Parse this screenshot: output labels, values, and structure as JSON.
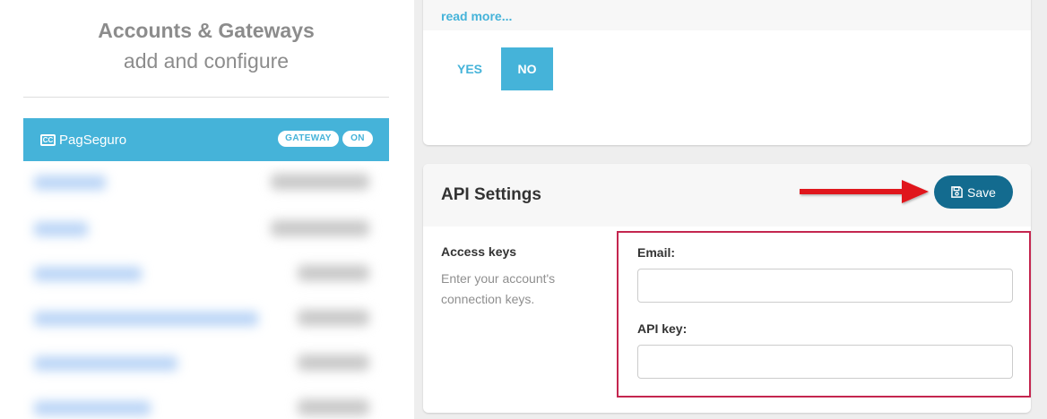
{
  "sidebar": {
    "title": "Accounts & Gateways",
    "subtitle": "add and configure",
    "active_account": {
      "icon": "credit-card-icon",
      "icon_text": "CC",
      "name": "PagSeguro",
      "type_badge": "GATEWAY",
      "status_badge": "ON"
    }
  },
  "integration_card": {
    "read_more": "read more...",
    "yes_label": "YES",
    "no_label": "NO",
    "selected": "NO"
  },
  "api_settings": {
    "title": "API Settings",
    "save_label": "Save",
    "save_icon": "floppy-disk-icon",
    "access_keys_title": "Access keys",
    "access_keys_description": "Enter your account's connection keys.",
    "fields": {
      "email": {
        "label": "Email:",
        "value": "",
        "placeholder": ""
      },
      "api_key": {
        "label": "API key:",
        "value": "",
        "placeholder": ""
      }
    }
  },
  "colors": {
    "accent": "#45b3d9",
    "save_button": "#136b8f",
    "highlight": "#c4264f",
    "arrow": "#e0151b"
  }
}
